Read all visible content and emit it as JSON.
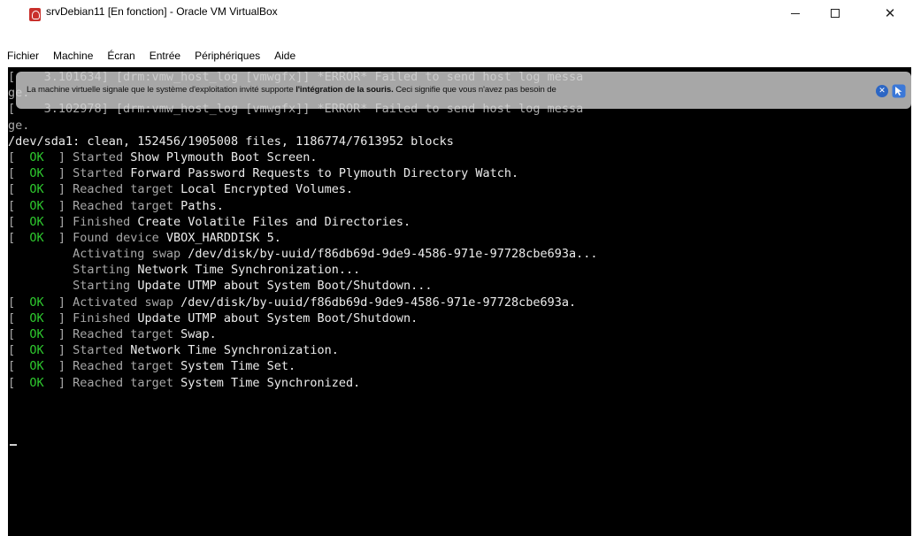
{
  "window": {
    "title": "srvDebian11 [En fonction] - Oracle VM VirtualBox",
    "icon": "virtualbox-icon",
    "controls": {
      "minimize": "minimize-icon",
      "maximize": "maximize-icon",
      "close": "✕"
    }
  },
  "menubar": {
    "items": [
      "Fichier",
      "Machine",
      "Écran",
      "Entrée",
      "Périphériques",
      "Aide"
    ]
  },
  "notification": {
    "text_before": "La machine virtuelle signale que le système d'exploitation invité supporte ",
    "text_bold": "l'intégration de la souris.",
    "text_after": " Ceci signifie que vous n'avez pas besoin de",
    "close_icon": "close-notification-icon",
    "toggle_icon": "mouse-integration-icon",
    "close_glyph": "✕"
  },
  "terminal": {
    "lines": [
      {
        "prefix": "[    3.101634] ",
        "text": "[drm:vmw_host_log [vmwgfx]] *ERROR* Failed to send host log messa"
      },
      {
        "prefix": "",
        "text": "ge."
      },
      {
        "prefix": "[    3.102978] ",
        "text": "[drm:vmw_host_log [vmwgfx]] *ERROR* Failed to send host log messa"
      },
      {
        "prefix": "",
        "text": "ge."
      },
      {
        "prefix": "",
        "text": "/dev/sda1: clean, 152456/1905008 files, 1186774/7613952 blocks"
      }
    ],
    "boot": [
      {
        "status": "OK",
        "verb": "Started ",
        "target": "Show Plymouth Boot Screen."
      },
      {
        "status": "OK",
        "verb": "Started ",
        "target": "Forward Password Requests to Plymouth Directory Watch."
      },
      {
        "status": "OK",
        "verb": "Reached target ",
        "target": "Local Encrypted Volumes."
      },
      {
        "status": "OK",
        "verb": "Reached target ",
        "target": "Paths."
      },
      {
        "status": "OK",
        "verb": "Finished ",
        "target": "Create Volatile Files and Directories."
      },
      {
        "status": "OK",
        "verb": "Found device ",
        "target": "VBOX_HARDDISK 5."
      },
      {
        "status": "",
        "verb": "Activating swap ",
        "target": "/dev/disk/by-uuid/f86db69d-9de9-4586-971e-97728cbe693a..."
      },
      {
        "status": "",
        "verb": "Starting ",
        "target": "Network Time Synchronization..."
      },
      {
        "status": "",
        "verb": "Starting ",
        "target": "Update UTMP about System Boot/Shutdown..."
      },
      {
        "status": "OK",
        "verb": "Activated swap ",
        "target": "/dev/disk/by-uuid/f86db69d-9de9-4586-971e-97728cbe693a."
      },
      {
        "status": "OK",
        "verb": "Finished ",
        "target": "Update UTMP about System Boot/Shutdown."
      },
      {
        "status": "OK",
        "verb": "Reached target ",
        "target": "Swap."
      },
      {
        "status": "OK",
        "verb": "Started ",
        "target": "Network Time Synchronization."
      },
      {
        "status": "OK",
        "verb": "Reached target ",
        "target": "System Time Set."
      },
      {
        "status": "OK",
        "verb": "Reached target ",
        "target": "System Time Synchronized."
      }
    ],
    "cursor": "_"
  },
  "colors": {
    "ok_green": "#2ec92e",
    "terminal_bg": "#000000",
    "terminal_text": "#c8c8c8",
    "notification_bg": "#d6d6d6",
    "titlebar_bg": "#ffffff"
  }
}
